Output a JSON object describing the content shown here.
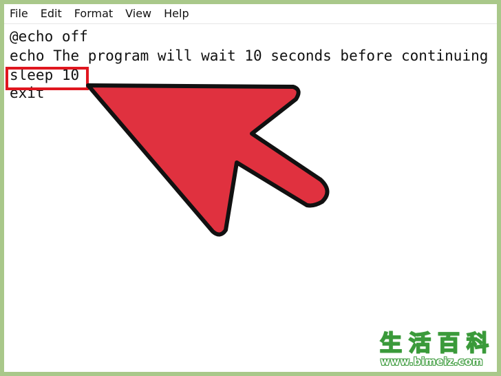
{
  "menubar": {
    "items": [
      "File",
      "Edit",
      "Format",
      "View",
      "Help"
    ]
  },
  "editor": {
    "lines": [
      "@echo off",
      "echo The program will wait 10 seconds before continuing",
      "sleep 10",
      "exit"
    ],
    "highlighted_line_index": 2
  },
  "overlay": {
    "arrow_color": "#e0313f",
    "arrow_outline": "#111111",
    "highlight_color": "#e0161f"
  },
  "watermark": {
    "chars": [
      "生",
      "活",
      "百",
      "科"
    ],
    "url": "www.bimeiz.com"
  }
}
